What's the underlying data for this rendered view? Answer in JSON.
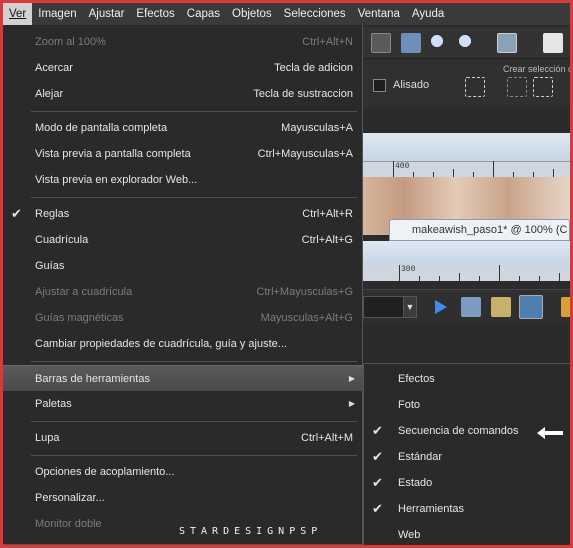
{
  "menubar": {
    "items": [
      "Ver",
      "Imagen",
      "Ajustar",
      "Efectos",
      "Capas",
      "Objetos",
      "Selecciones",
      "Ventana",
      "Ayuda"
    ]
  },
  "toolbar": {
    "aliased_label": "Alisado",
    "create_selection_label": "Crear selección d"
  },
  "ruler": {
    "top_label": "400",
    "bottom_label": "300"
  },
  "document": {
    "tab_title": "makeawish_paso1* @ 100% (C"
  },
  "main_menu": {
    "items": [
      {
        "label": "Zoom al 100%",
        "shortcut": "Ctrl+Alt+N",
        "disabled": true
      },
      {
        "label": "Acercar",
        "shortcut": "Tecla de adicion"
      },
      {
        "label": "Alejar",
        "shortcut": "Tecla de sustraccion"
      },
      {
        "label": "Modo de pantalla completa",
        "shortcut": "Mayusculas+A"
      },
      {
        "label": "Vista previa a pantalla completa",
        "shortcut": "Ctrl+Mayusculas+A"
      },
      {
        "label": "Vista previa en explorador Web...",
        "shortcut": ""
      },
      {
        "label": "Reglas",
        "shortcut": "Ctrl+Alt+R",
        "checked": true
      },
      {
        "label": "Cuadrícula",
        "shortcut": "Ctrl+Alt+G"
      },
      {
        "label": "Guías",
        "shortcut": ""
      },
      {
        "label": "Ajustar a cuadrícula",
        "shortcut": "Ctrl+Mayusculas+G",
        "disabled": true
      },
      {
        "label": "Guías magnéticas",
        "shortcut": "Mayusculas+Alt+G",
        "disabled": true
      },
      {
        "label": "Cambiar propiedades de cuadrícula, guía y ajuste...",
        "shortcut": ""
      },
      {
        "label": "Barras de herramientas",
        "shortcut": "",
        "submenu": true
      },
      {
        "label": "Paletas",
        "shortcut": "",
        "submenu": true
      },
      {
        "label": "Lupa",
        "shortcut": "Ctrl+Alt+M"
      },
      {
        "label": "Opciones de acoplamiento...",
        "shortcut": ""
      },
      {
        "label": "Personalizar...",
        "shortcut": ""
      },
      {
        "label": "Monitor doble",
        "shortcut": "",
        "disabled": true
      }
    ]
  },
  "sub_menu": {
    "items": [
      {
        "label": "Efectos",
        "checked": false
      },
      {
        "label": "Foto",
        "checked": false
      },
      {
        "label": "Secuencia de comandos",
        "checked": true
      },
      {
        "label": "Estándar",
        "checked": true
      },
      {
        "label": "Estado",
        "checked": true
      },
      {
        "label": "Herramientas",
        "checked": true
      },
      {
        "label": "Web",
        "checked": false
      }
    ]
  },
  "watermark": "STARDESIGNPSP"
}
